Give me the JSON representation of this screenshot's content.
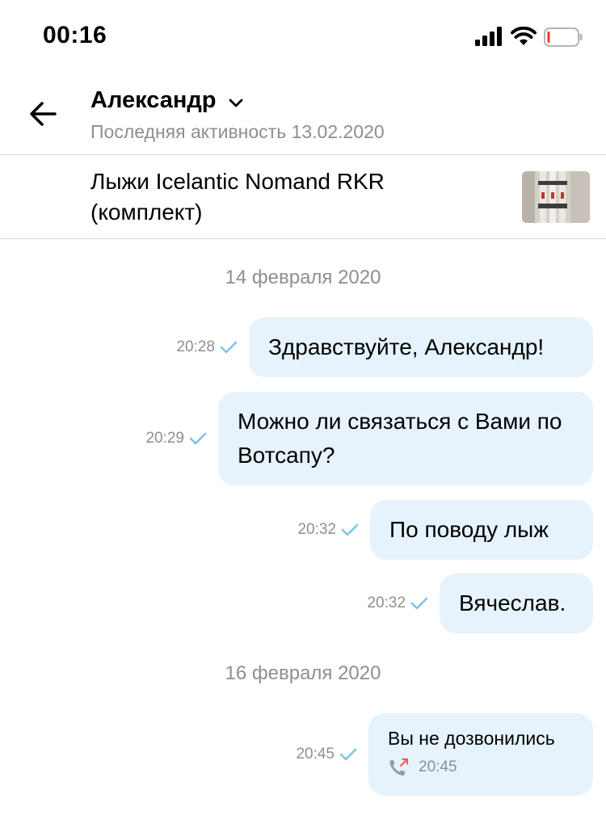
{
  "status_bar": {
    "time": "00:16"
  },
  "header": {
    "contact_name": "Александр",
    "last_seen": "Последняя активность 13.02.2020"
  },
  "listing": {
    "title": "Лыжи Icelantic Nomand RKR (комплект)"
  },
  "colors": {
    "bubble": "#e6f3fd",
    "check": "#7cc3ec",
    "meta": "#8e8e93",
    "missed": "#f05a5a"
  },
  "conversation": {
    "date_1": "14 февраля 2020",
    "date_2": "16 февраля 2020",
    "messages": [
      {
        "text": "Здравствуйте, Александр!",
        "time": "20:28"
      },
      {
        "text": "Можно ли связаться с Вами по Вотсапу?",
        "time": "20:29"
      },
      {
        "text": "По поводу лыж",
        "time": "20:32"
      },
      {
        "text": "Вячеслав.",
        "time": "20:32"
      }
    ],
    "call": {
      "text": "Вы не дозвонились",
      "call_time": "20:45",
      "time": "20:45",
      "icon": "missed-call-icon"
    }
  }
}
